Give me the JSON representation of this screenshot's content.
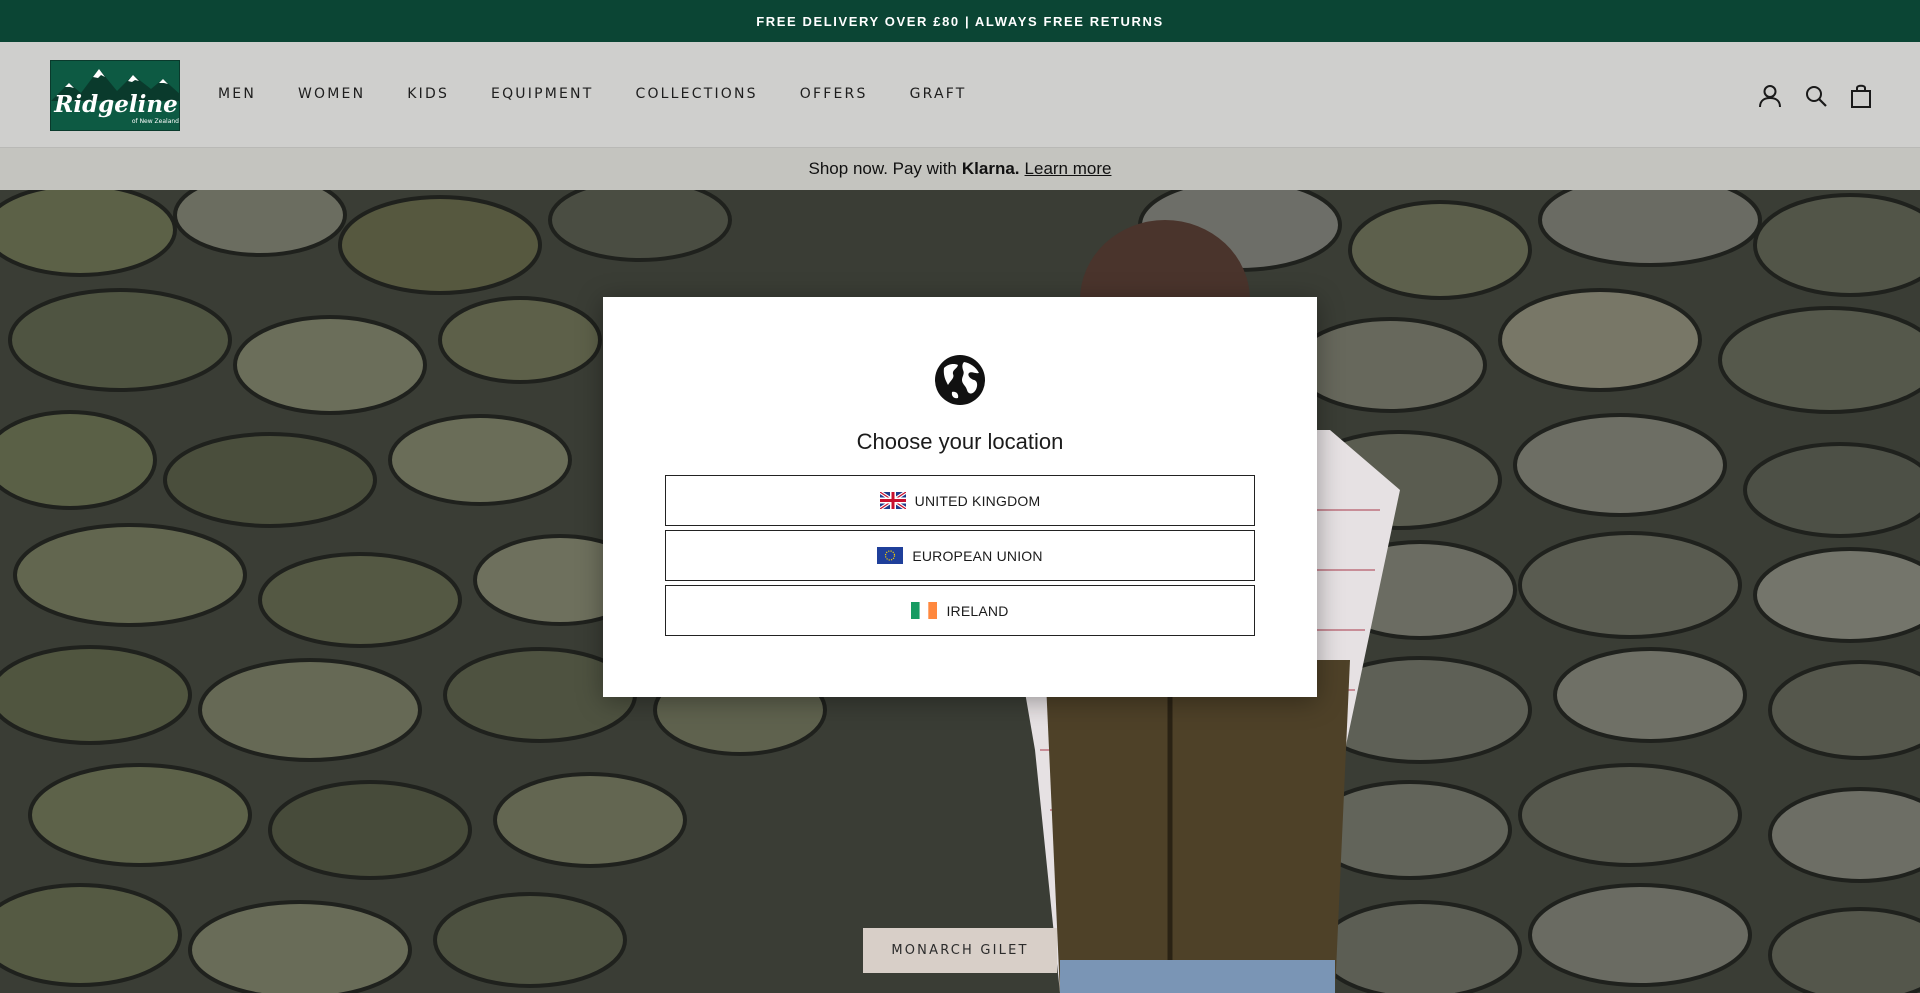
{
  "announcement": {
    "text": "FREE DELIVERY OVER £80 | ALWAYS FREE RETURNS"
  },
  "header": {
    "logo": {
      "name": "Ridgeline",
      "sub": "of New Zealand"
    },
    "nav": [
      "MEN",
      "WOMEN",
      "KIDS",
      "EQUIPMENT",
      "COLLECTIONS",
      "OFFERS",
      "GRAFT"
    ],
    "icons": [
      "account-icon",
      "search-icon",
      "cart-icon"
    ]
  },
  "klarna": {
    "prefix": "Shop now. Pay with",
    "brand": "Klarna.",
    "link": "Learn more"
  },
  "hero": {
    "product_button": "MONARCH GILET"
  },
  "modal": {
    "close_glyph": "",
    "title": "Choose your location",
    "locations": [
      {
        "label": "UNITED KINGDOM",
        "flag": "uk-flag-icon"
      },
      {
        "label": "EUROPEAN UNION",
        "flag": "eu-flag-icon"
      },
      {
        "label": "IRELAND",
        "flag": "ireland-flag-icon"
      }
    ]
  },
  "colors": {
    "announcement_bg": "#0b4534",
    "header_bg": "#cfcfcd",
    "klarna_bg": "#c4c4bf",
    "logo_bg": "#0d5a43",
    "product_button_bg": "#d8cfc8"
  }
}
